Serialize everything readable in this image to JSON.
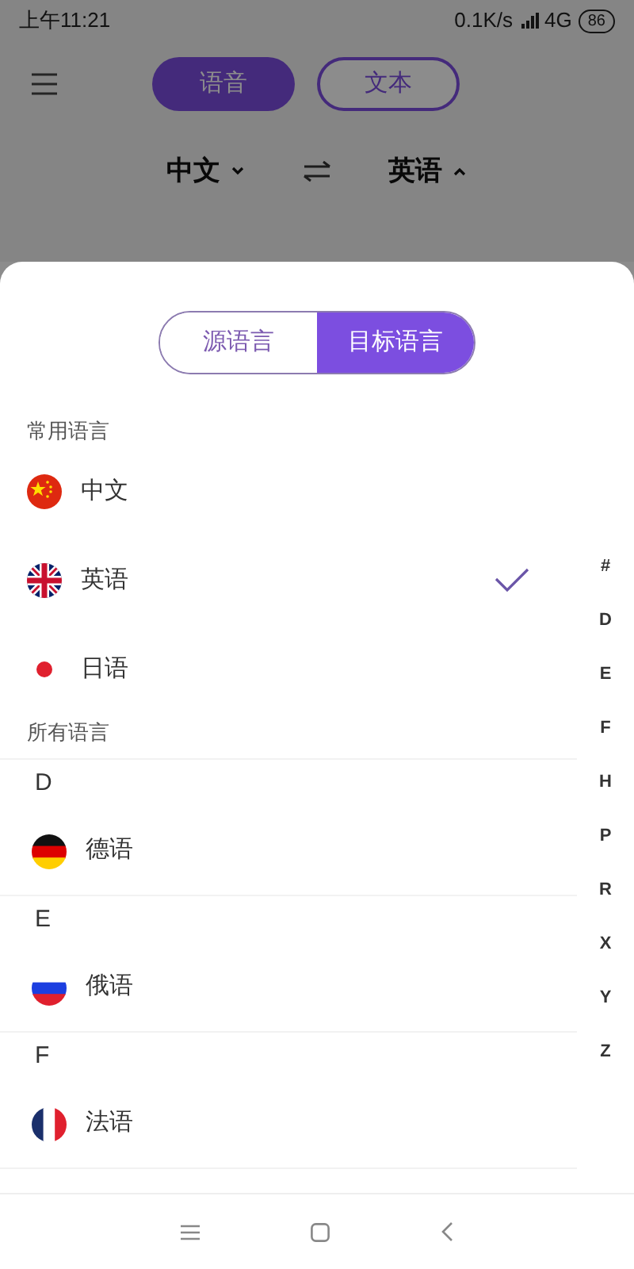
{
  "status_bar": {
    "time": "上午11:21",
    "speed": "0.1K/s",
    "network": "4G",
    "battery": "86"
  },
  "header": {
    "modes": [
      {
        "label": "语音",
        "selected": true
      },
      {
        "label": "文本",
        "selected": false
      }
    ]
  },
  "language_bar": {
    "source": "中文",
    "target": "英语"
  },
  "sheet": {
    "tabs": [
      {
        "label": "源语言",
        "selected": false
      },
      {
        "label": "目标语言",
        "selected": true
      }
    ],
    "common_title": "常用语言",
    "common": [
      {
        "name": "中文",
        "kind": "china",
        "selected": false
      },
      {
        "name": "英语",
        "kind": "uk",
        "selected": true
      },
      {
        "name": "日语",
        "kind": "japan",
        "selected": false
      }
    ],
    "all_title": "所有语言",
    "groups": [
      {
        "letter": "D",
        "items": [
          {
            "name": "德语",
            "kind": "germany"
          }
        ]
      },
      {
        "letter": "E",
        "items": [
          {
            "name": "俄语",
            "kind": "russia"
          }
        ]
      },
      {
        "letter": "F",
        "items": [
          {
            "name": "法语",
            "kind": "france"
          }
        ]
      }
    ],
    "index": [
      "#",
      "D",
      "E",
      "F",
      "H",
      "P",
      "R",
      "X",
      "Y",
      "Z"
    ]
  }
}
